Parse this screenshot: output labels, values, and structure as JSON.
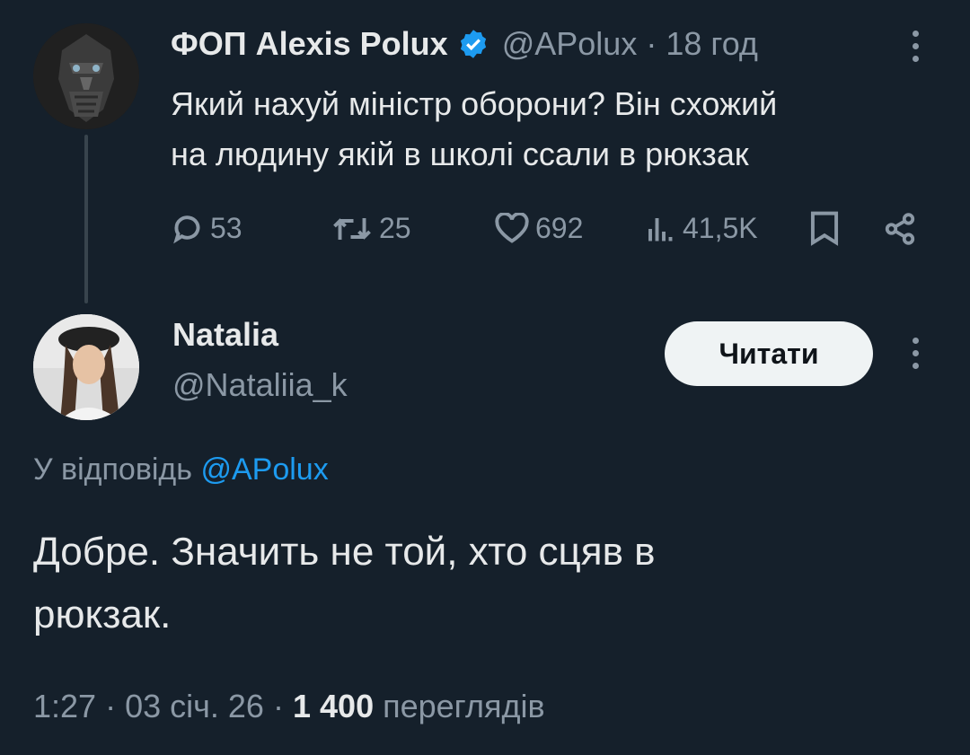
{
  "parent_tweet": {
    "author_name": "ФОП Alexis Polux",
    "handle": "@APolux",
    "separator": "·",
    "time_ago": "18 год",
    "text_line1": "Який нахуй міністр оборони? Він схожий",
    "text_line2": "на людину якій в школі ссали в рюкзак",
    "replies": "53",
    "reposts": "25",
    "likes": "692",
    "views": "41,5K",
    "icons": [
      "verified-badge-icon",
      "reply-icon",
      "repost-icon",
      "like-icon",
      "views-icon",
      "bookmark-icon",
      "share-icon",
      "more-icon"
    ]
  },
  "reply_tweet": {
    "author_name": "Natalia",
    "handle": "@Nataliia_k",
    "follow_label": "Читати",
    "reply_to_prefix": "У відповідь",
    "reply_to_handle": "@APolux",
    "text_line1": "Добре. Значить не той, хто сцяв в",
    "text_line2": "рюкзак.",
    "time": "1:27",
    "sep1": "·",
    "date": "03 січ. 26",
    "sep2": "·",
    "views_count": "1 400",
    "views_label": "переглядів"
  },
  "colors": {
    "background": "#15202b",
    "text": "#e7e9ea",
    "muted": "#8b98a5",
    "accent": "#1d9bf0",
    "button_bg": "#eff3f4"
  }
}
